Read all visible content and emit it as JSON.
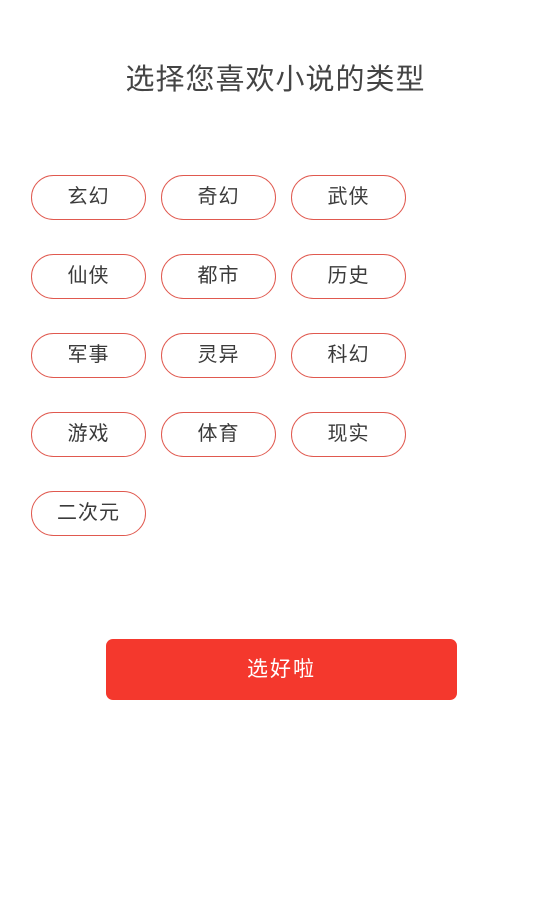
{
  "page": {
    "title": "选择您喜欢小说的类型",
    "background_color": "#ffffff",
    "title_color": "#444444"
  },
  "tags": {
    "accent_color": "#e0594f",
    "items": [
      {
        "label": "玄幻",
        "selected": false
      },
      {
        "label": "奇幻",
        "selected": false
      },
      {
        "label": "武侠",
        "selected": false
      },
      {
        "label": "仙侠",
        "selected": false
      },
      {
        "label": "都市",
        "selected": false
      },
      {
        "label": "历史",
        "selected": false
      },
      {
        "label": "军事",
        "selected": false
      },
      {
        "label": "灵异",
        "selected": false
      },
      {
        "label": "科幻",
        "selected": false
      },
      {
        "label": "游戏",
        "selected": false
      },
      {
        "label": "体育",
        "selected": false
      },
      {
        "label": "现实",
        "selected": false
      },
      {
        "label": "二次元",
        "selected": false
      }
    ]
  },
  "submit": {
    "label": "选好啦",
    "background_color": "#f4382d",
    "text_color": "#ffffff"
  }
}
